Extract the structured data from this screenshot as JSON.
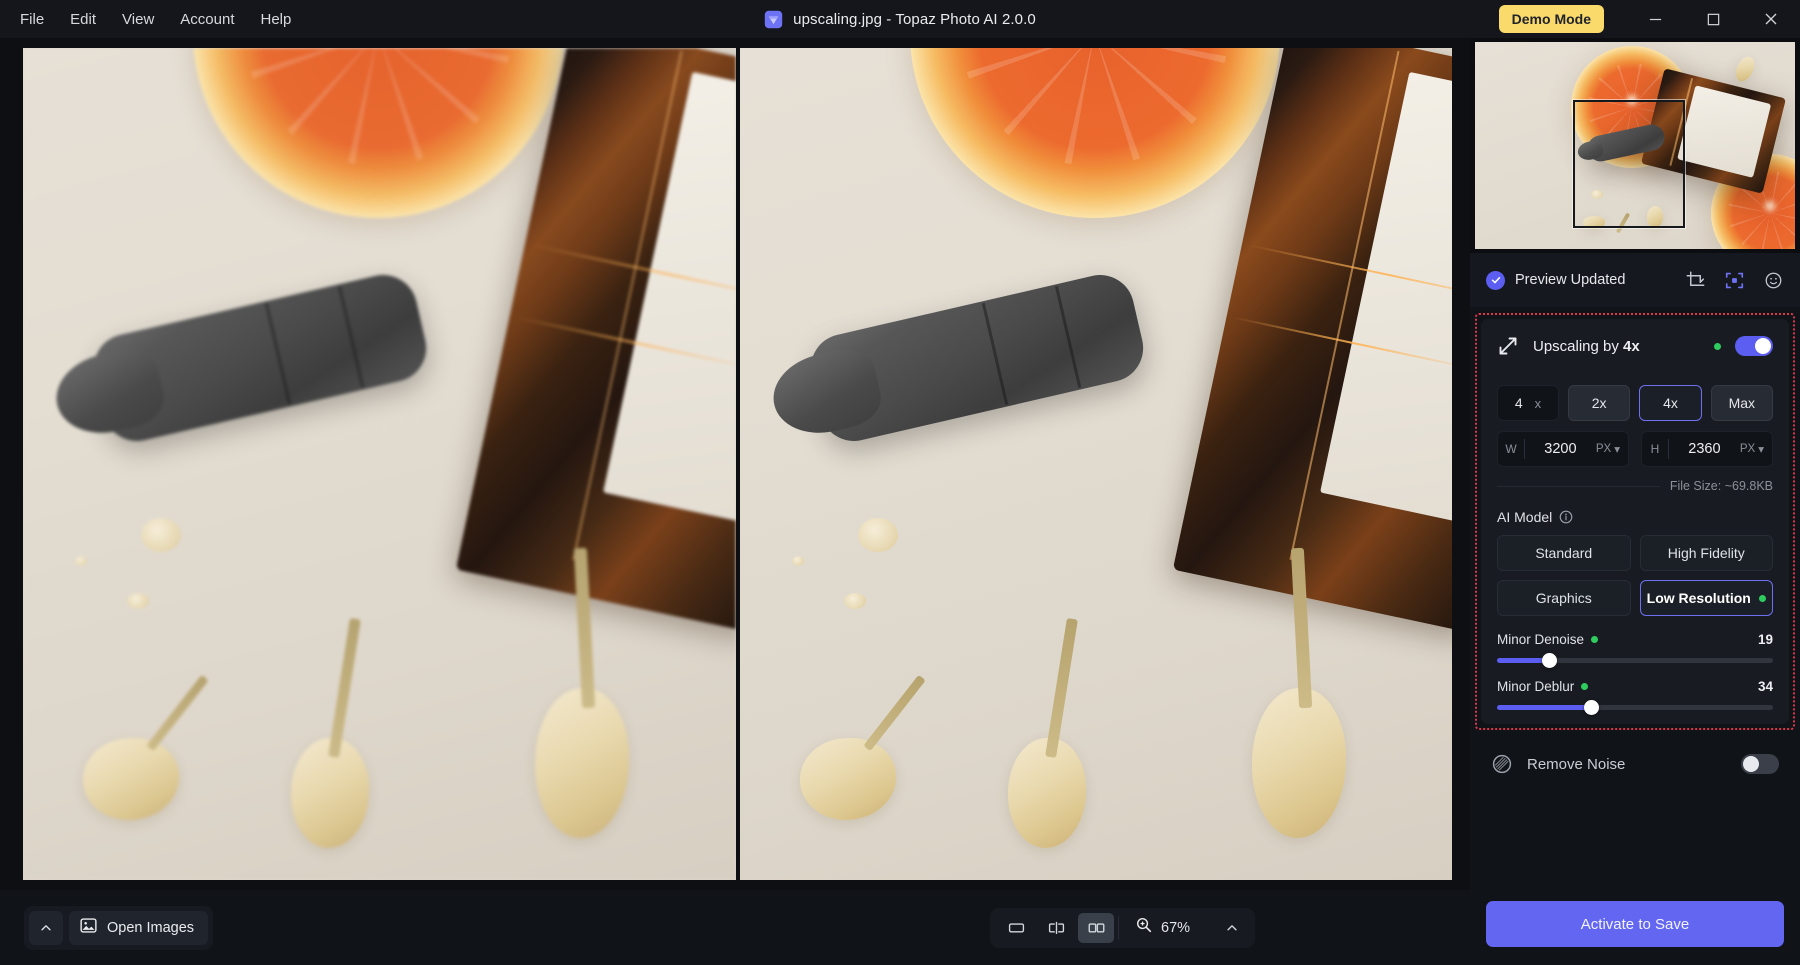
{
  "window": {
    "title": "upscaling.jpg - Topaz Photo AI 2.0.0",
    "logo_icon": "topaz-gem-icon",
    "demo_badge": "Demo Mode",
    "minimize_icon": "minimize-icon",
    "maximize_icon": "maximize-icon",
    "close_icon": "close-icon"
  },
  "menu": {
    "items": [
      {
        "label": "File"
      },
      {
        "label": "Edit"
      },
      {
        "label": "View"
      },
      {
        "label": "Account"
      },
      {
        "label": "Help"
      }
    ]
  },
  "sidebar": {
    "preview": {
      "status_label": "Preview Updated",
      "status_icon": "check-circle-icon",
      "tools": [
        {
          "name": "crop-icon",
          "active": false
        },
        {
          "name": "fit-to-screen-icon",
          "active": true
        },
        {
          "name": "face-detect-icon",
          "active": false
        }
      ]
    },
    "enhancement": {
      "icon": "upscale-arrows-icon",
      "title_prefix": "Upscaling by ",
      "title_value": "4x",
      "enabled": true,
      "scale": {
        "value": "4",
        "unit": "x",
        "presets": [
          {
            "label": "2x",
            "selected": false
          },
          {
            "label": "4x",
            "selected": true
          },
          {
            "label": "Max",
            "selected": false
          }
        ]
      },
      "dimensions": {
        "width_label": "W",
        "width_value": "3200",
        "width_unit": "PX",
        "height_label": "H",
        "height_value": "2360",
        "height_unit": "PX"
      },
      "file_size": "File Size: ~69.8KB",
      "ai_model": {
        "label": "AI Model",
        "info_icon": "info-icon",
        "options": [
          {
            "label": "Standard",
            "selected": false
          },
          {
            "label": "High Fidelity",
            "selected": false
          },
          {
            "label": "Graphics",
            "selected": false
          },
          {
            "label": "Low Resolution",
            "selected": true
          }
        ]
      },
      "sliders": [
        {
          "label": "Minor Denoise",
          "value": "19",
          "percent": 19
        },
        {
          "label": "Minor Deblur",
          "value": "34",
          "percent": 34
        }
      ]
    },
    "remove_noise": {
      "label": "Remove Noise",
      "icon": "noise-sphere-icon",
      "enabled": false
    },
    "save_button": "Activate to Save"
  },
  "bottombar": {
    "collapse_icon": "chevron-up-icon",
    "open_images": {
      "label": "Open Images",
      "icon": "image-icon"
    },
    "view_modes": [
      {
        "name": "single-view-icon",
        "active": false
      },
      {
        "name": "split-view-icon",
        "active": false
      },
      {
        "name": "side-by-side-view-icon",
        "active": true
      }
    ],
    "zoom": {
      "icon": "magnifier-plus-icon",
      "level": "67%",
      "chevron_icon": "chevron-up-icon"
    }
  },
  "colors": {
    "accent": "#5b5ef0",
    "save_button": "#6366f1",
    "demo_badge": "#fada6a",
    "highlight_border": "#e0364a",
    "status_dot": "#2ecc5f",
    "window_bg": "#14161b",
    "panel_bg": "#101318"
  }
}
